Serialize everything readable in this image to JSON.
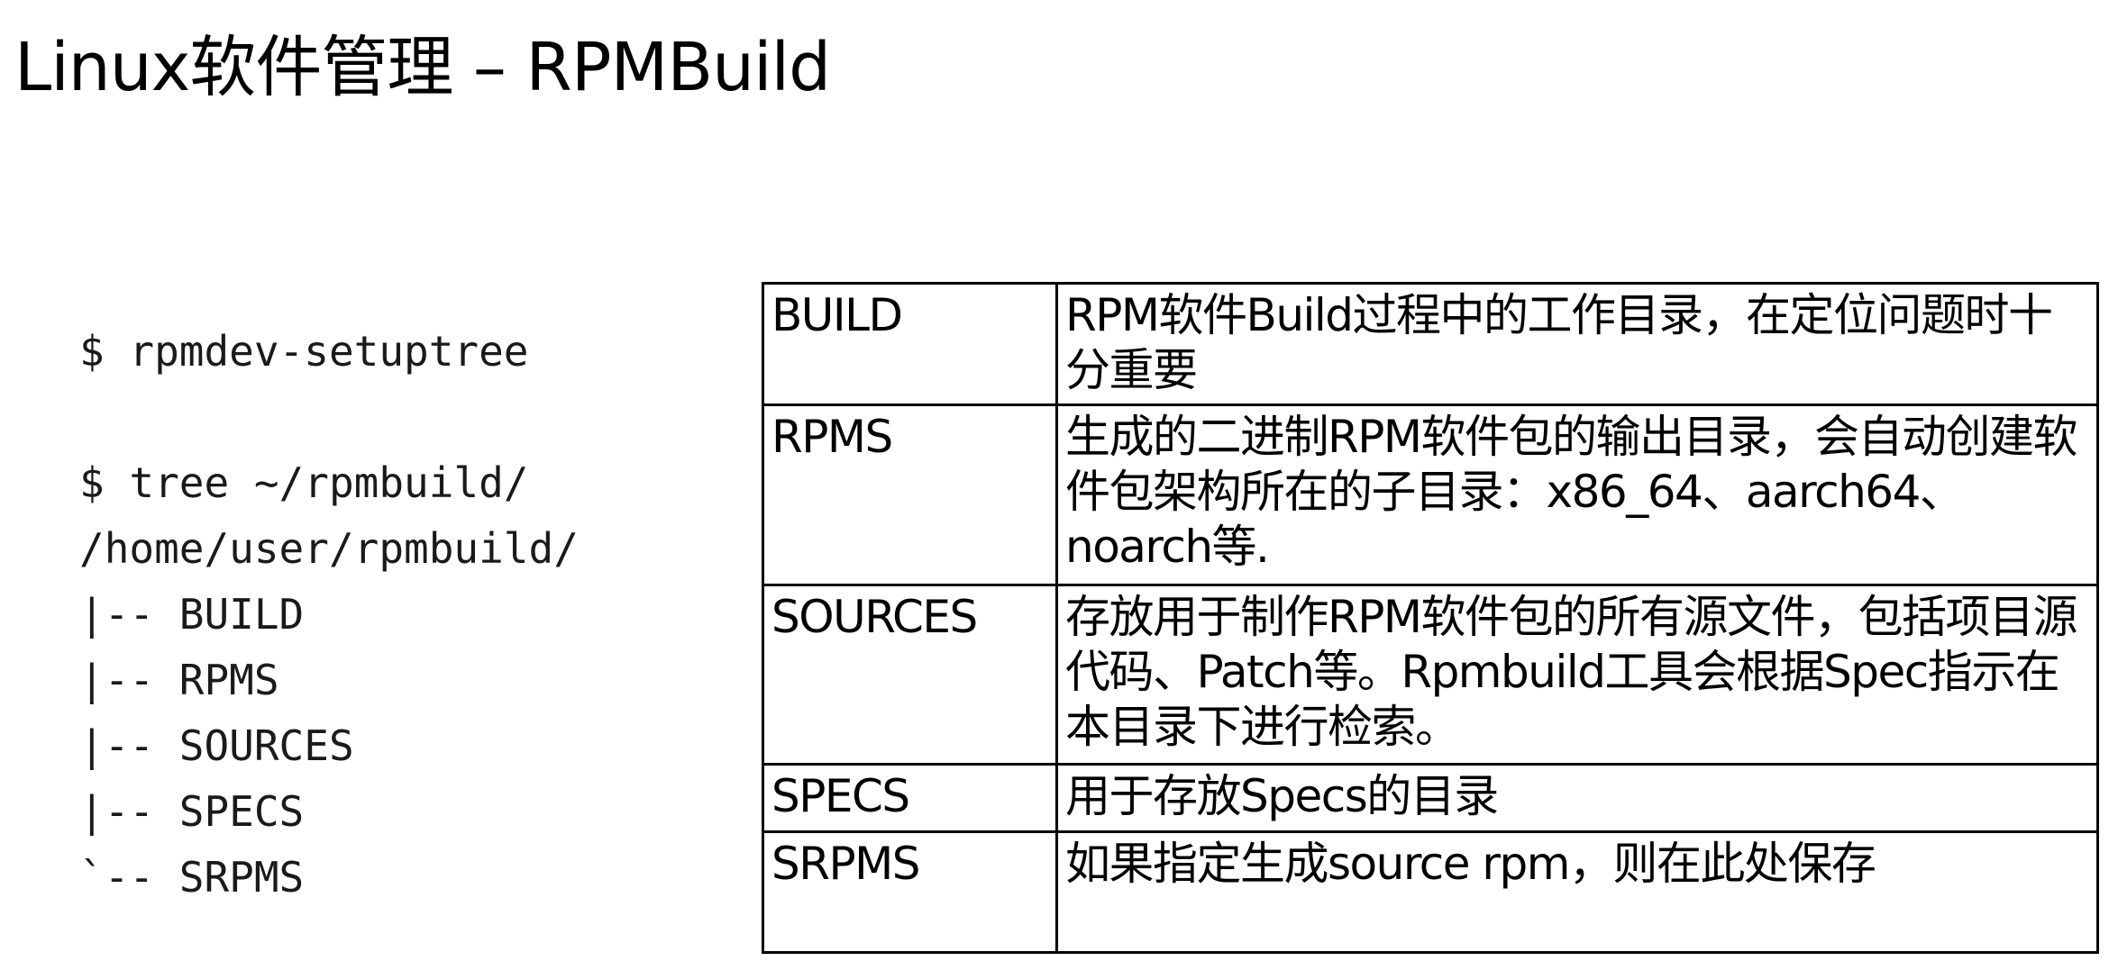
{
  "title": "Linux软件管理 – RPMBuild",
  "code": {
    "lines": [
      "$ rpmdev-setuptree",
      "",
      "$ tree ~/rpmbuild/",
      "/home/user/rpmbuild/",
      "|-- BUILD",
      "|-- RPMS",
      "|-- SOURCES",
      "|-- SPECS",
      "`-- SRPMS"
    ]
  },
  "table": {
    "rows": [
      {
        "name": "BUILD",
        "desc": "RPM软件Build过程中的工作目录，在定位问题时十分重要"
      },
      {
        "name": "RPMS",
        "desc": "生成的二进制RPM软件包的输出目录，会自动创建软件包架构所在的子目录：x86_64、aarch64、noarch等."
      },
      {
        "name": "SOURCES",
        "desc": "存放用于制作RPM软件包的所有源文件，包括项目源代码、Patch等。Rpmbuild工具会根据Spec指示在本目录下进行检索。"
      },
      {
        "name": "SPECS",
        "desc": "用于存放Specs的目录"
      },
      {
        "name": "SRPMS",
        "desc": "如果指定生成source rpm，则在此处保存"
      }
    ]
  }
}
